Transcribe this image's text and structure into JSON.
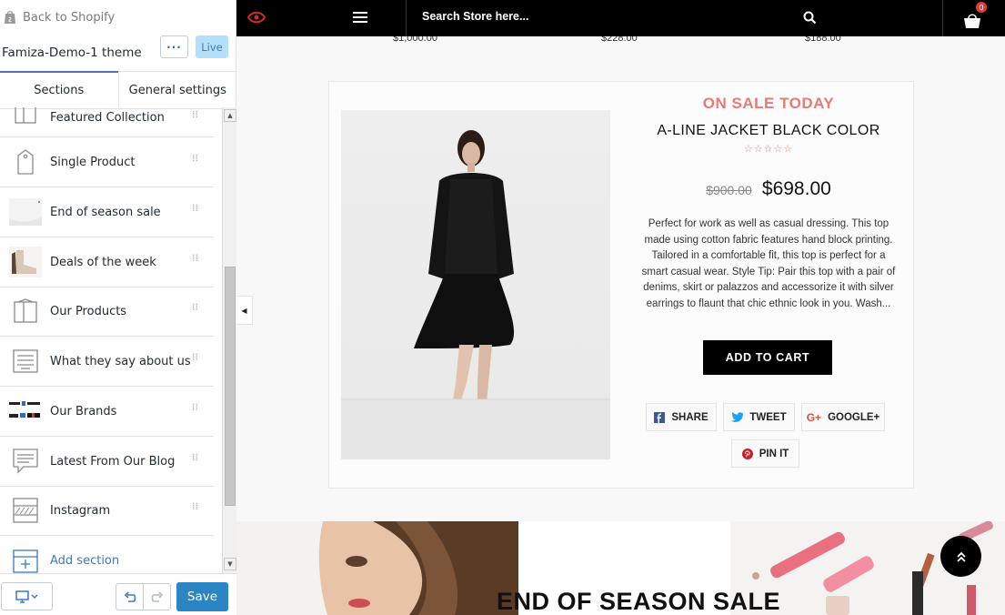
{
  "sidebar": {
    "back_label": "Back to Shopify",
    "theme_name": "Famiza-Demo-1 theme",
    "more_label": "···",
    "live_label": "Live",
    "tabs": [
      {
        "label": "Sections",
        "active": true
      },
      {
        "label": "General settings",
        "active": false
      }
    ],
    "sections": [
      {
        "label": "Featured Collection",
        "icon": "collection-icon"
      },
      {
        "label": "Single Product",
        "icon": "tag-icon"
      },
      {
        "label": "End of season sale",
        "icon": "sale-thumbnail"
      },
      {
        "label": "Deals of the week",
        "icon": "boot-thumbnail"
      },
      {
        "label": "Our Products",
        "icon": "collection-icon"
      },
      {
        "label": "What they say about us",
        "icon": "testimonial-icon"
      },
      {
        "label": "Our Brands",
        "icon": "brands-logo-thumbnail"
      },
      {
        "label": "Latest From Our Blog",
        "icon": "blog-icon"
      },
      {
        "label": "Instagram",
        "icon": "gallery-icon"
      }
    ],
    "add_section_label": "Add section",
    "save_label": "Save"
  },
  "store": {
    "search_placeholder": "Search Store here...",
    "cart_count": "0",
    "top_prices": [
      "$1,000.00",
      "$228.00",
      "$188.00"
    ],
    "product": {
      "badge": "ON SALE TODAY",
      "title": "A-LINE JACKET BLACK COLOR",
      "rating_stars": "☆☆☆☆☆",
      "old_price": "$900.00",
      "new_price": "$698.00",
      "description": "Perfect for work as well as casual dressing. This top made using cotton fabric features hand block printing. Tailored in a comfortable fit, this top is perfect for a smart casual wear. Style Tip: Pair this top with a pair of denims, skirt or palazzos and accessorize it with silver earrings to flaunt that chic ethnic look in you. Wash...",
      "add_to_cart_label": "ADD TO CART",
      "share": {
        "facebook": "SHARE",
        "twitter": "TWEET",
        "google": "GOOGLE+",
        "pinterest": "PIN IT"
      }
    },
    "banner_title": "END OF SEASON SALE"
  },
  "colors": {
    "accent_sale": "#e87a75",
    "save_button": "#2b85c2",
    "live_badge": "#b4e0fa",
    "header_bg": "#000000"
  }
}
